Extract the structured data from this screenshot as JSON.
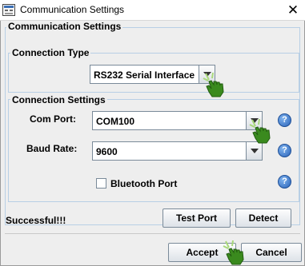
{
  "window": {
    "title": "Communication Settings",
    "close_glyph": "✕"
  },
  "main_panel": {
    "title": "Communication Settings"
  },
  "connection_type": {
    "title": "Connection Type",
    "selected": "RS232 Serial Interface"
  },
  "connection_settings": {
    "title": "Connection Settings",
    "com_port_label": "Com Port:",
    "com_port_value": "COM100",
    "baud_rate_label": "Baud Rate:",
    "baud_rate_value": "9600",
    "bluetooth_label": "Bluetooth Port",
    "bluetooth_checked": false
  },
  "help_glyph": "?",
  "status": {
    "text": "Successful!!!"
  },
  "buttons": {
    "test_port": "Test Port",
    "detect": "Detect",
    "accept": "Accept",
    "cancel": "Cancel"
  },
  "colors": {
    "border_blue": "#b8cfe5",
    "help_blue": "#2a63b8",
    "cursor_green": "#3a8a1e"
  }
}
